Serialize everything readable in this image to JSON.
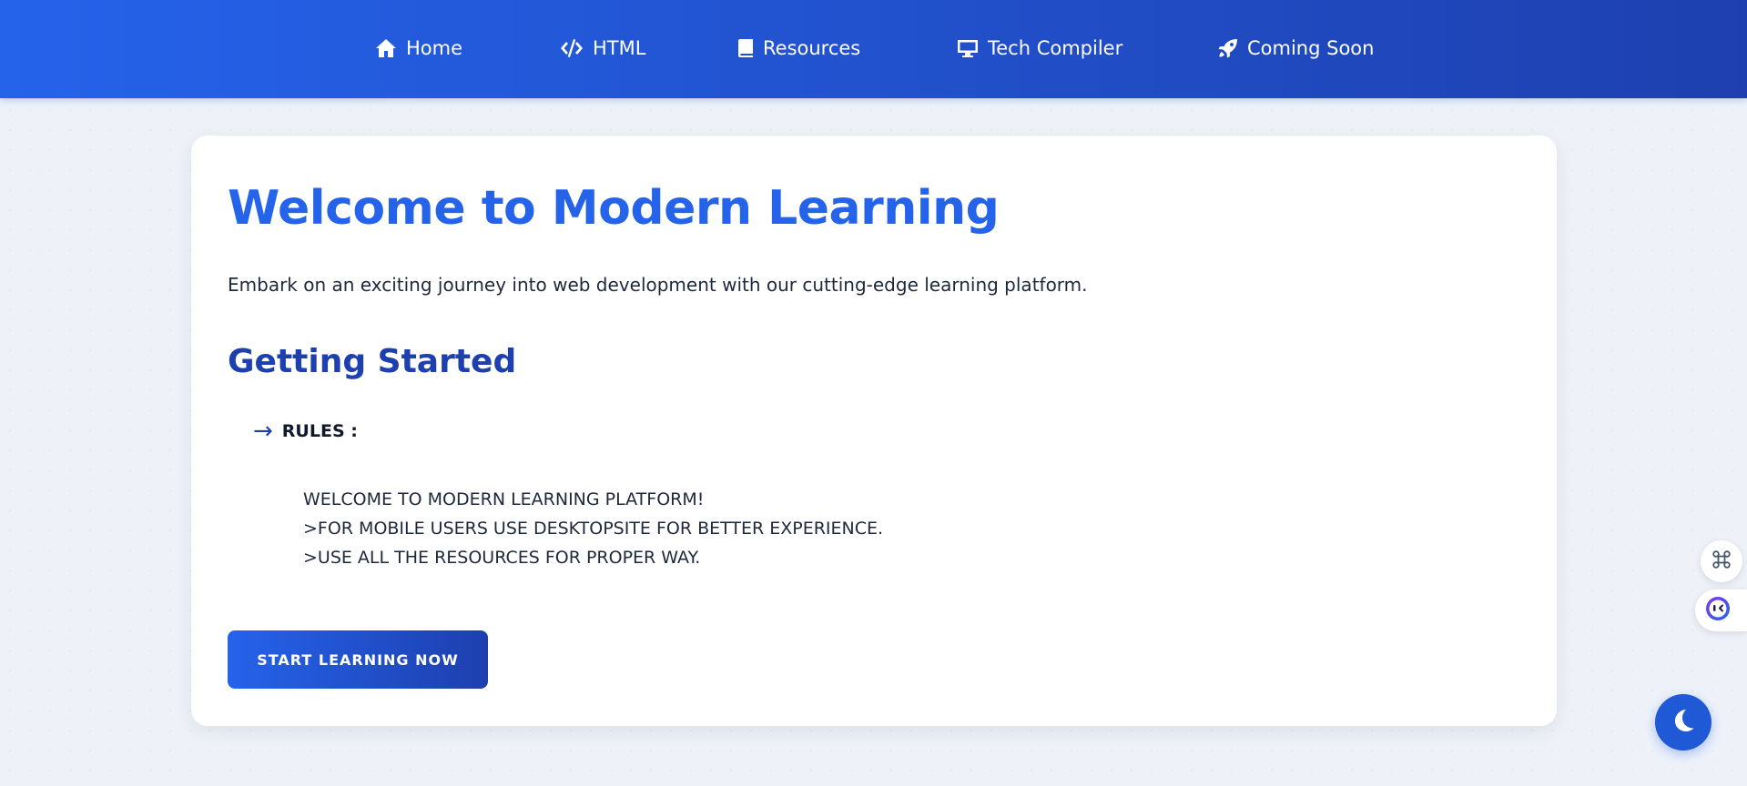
{
  "nav": {
    "items": [
      {
        "label": "Home",
        "icon": "home-icon"
      },
      {
        "label": "HTML",
        "icon": "code-icon"
      },
      {
        "label": "Resources",
        "icon": "book-icon"
      },
      {
        "label": "Tech Compiler",
        "icon": "desktop-icon"
      },
      {
        "label": "Coming Soon",
        "icon": "rocket-icon"
      }
    ]
  },
  "main": {
    "title": "Welcome to Modern Learning",
    "intro": "Embark on an exciting journey into web development with our cutting-edge learning platform.",
    "subtitle": "Getting Started",
    "rules_arrow": "→",
    "rules_label": "RULES :",
    "rules": [
      "WELCOME TO MODERN LEARNING PLATFORM!",
      ">FOR MOBILE USERS USE DESKTOPSITE FOR BETTER EXPERIENCE.",
      ">USE ALL THE RESOURCES FOR PROPER WAY."
    ],
    "cta_label": "START LEARNING NOW"
  },
  "widgets": {
    "shortcut_icon": "command-icon",
    "assistant_icon": "assistant-face-icon",
    "theme_icon": "moon-icon"
  },
  "colors": {
    "brand": "#2563eb",
    "brand_dark": "#1e40af",
    "background": "#eef2f8"
  }
}
